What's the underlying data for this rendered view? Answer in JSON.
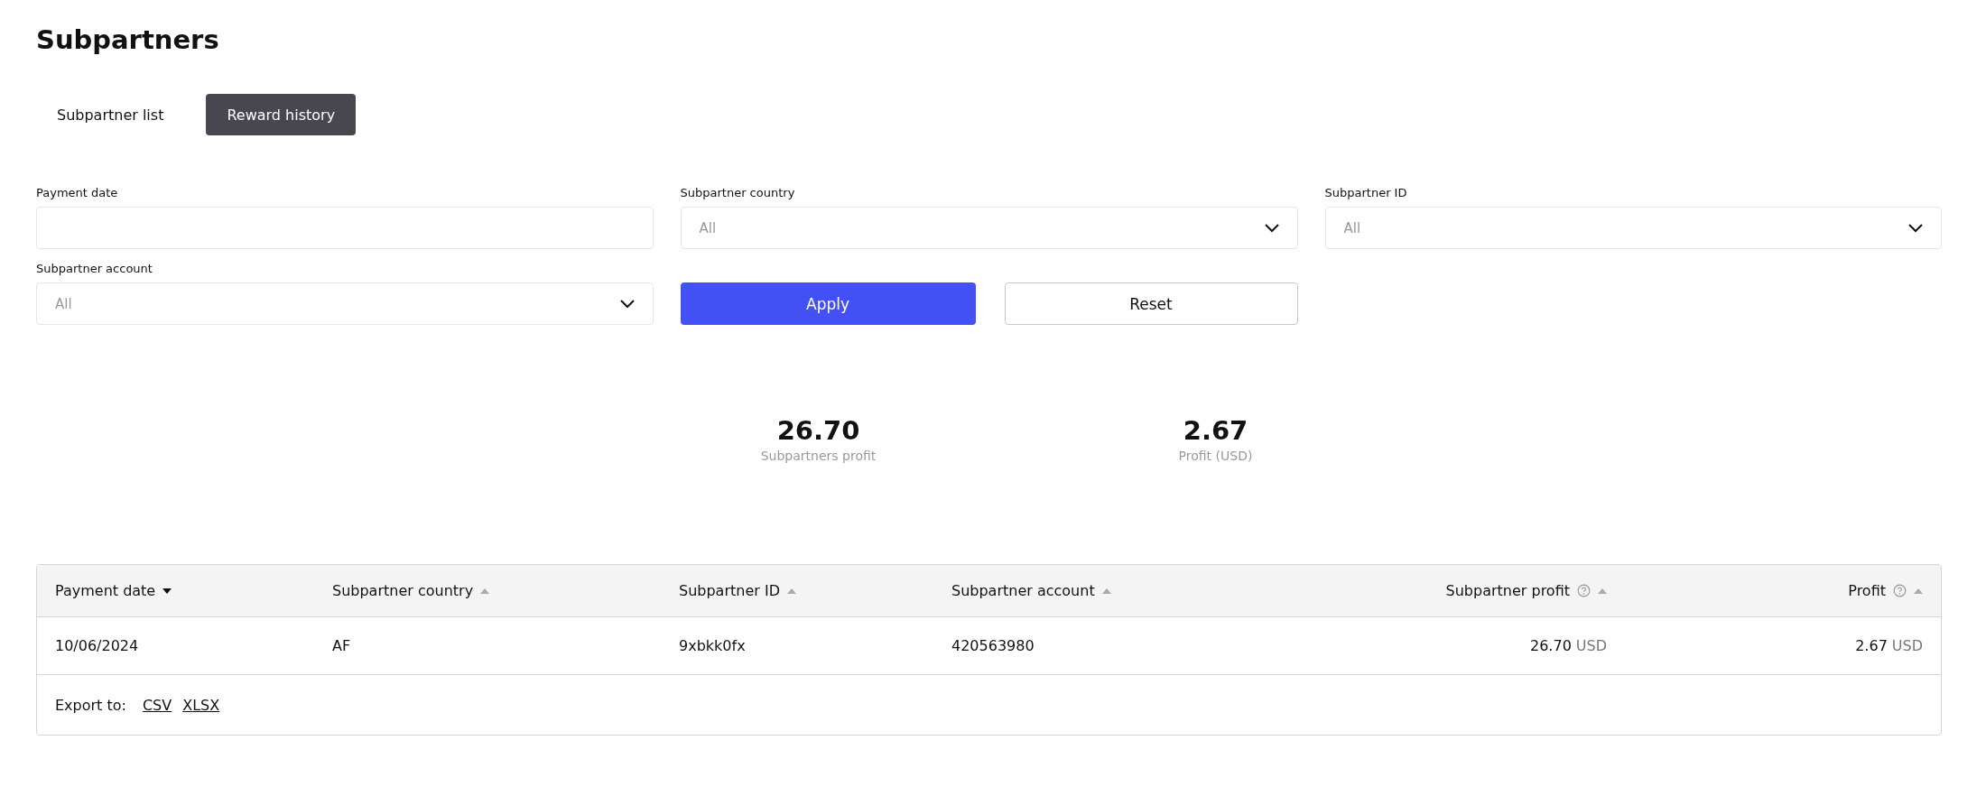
{
  "title": "Subpartners",
  "tabs": [
    {
      "label": "Subpartner list",
      "selected": false
    },
    {
      "label": "Reward history",
      "selected": true
    }
  ],
  "filters": [
    {
      "label": "Payment date",
      "kind": "input"
    },
    {
      "label": "Subpartner country",
      "kind": "select",
      "placeholder": "All"
    },
    {
      "label": "Subpartner ID",
      "kind": "select",
      "placeholder": "All"
    },
    {
      "label": "Subpartner account",
      "kind": "select",
      "placeholder": "All"
    }
  ],
  "buttons": [
    {
      "label": "Apply",
      "kind": "primary"
    },
    {
      "label": "Reset",
      "kind": "secondary"
    }
  ],
  "stats": [
    {
      "value": "26.70",
      "label": "Subpartners profit"
    },
    {
      "value": "2.67",
      "label": "Profit (USD)"
    }
  ],
  "table": {
    "columns": [
      {
        "label": "Payment date",
        "kind": "text",
        "sorted": true,
        "help": false
      },
      {
        "label": "Subpartner country",
        "kind": "text",
        "sorted": false,
        "help": false
      },
      {
        "label": "Subpartner ID",
        "kind": "text",
        "sorted": false,
        "help": false
      },
      {
        "label": "Subpartner account",
        "kind": "text",
        "sorted": false,
        "help": false
      },
      {
        "label": "Subpartner profit",
        "kind": "amount",
        "sorted": false,
        "help": true
      },
      {
        "label": "Profit",
        "kind": "amount",
        "sorted": false,
        "help": true
      }
    ],
    "rows": [
      [
        {
          "value": "10/06/2024"
        },
        {
          "value": "AF"
        },
        {
          "value": "9xbkk0fx"
        },
        {
          "value": "420563980"
        },
        {
          "value": "26.70",
          "unit": "USD"
        },
        {
          "value": "2.67",
          "unit": "USD"
        }
      ]
    ],
    "export": {
      "label": "Export to:",
      "links": [
        "CSV",
        "XLSX"
      ]
    }
  }
}
